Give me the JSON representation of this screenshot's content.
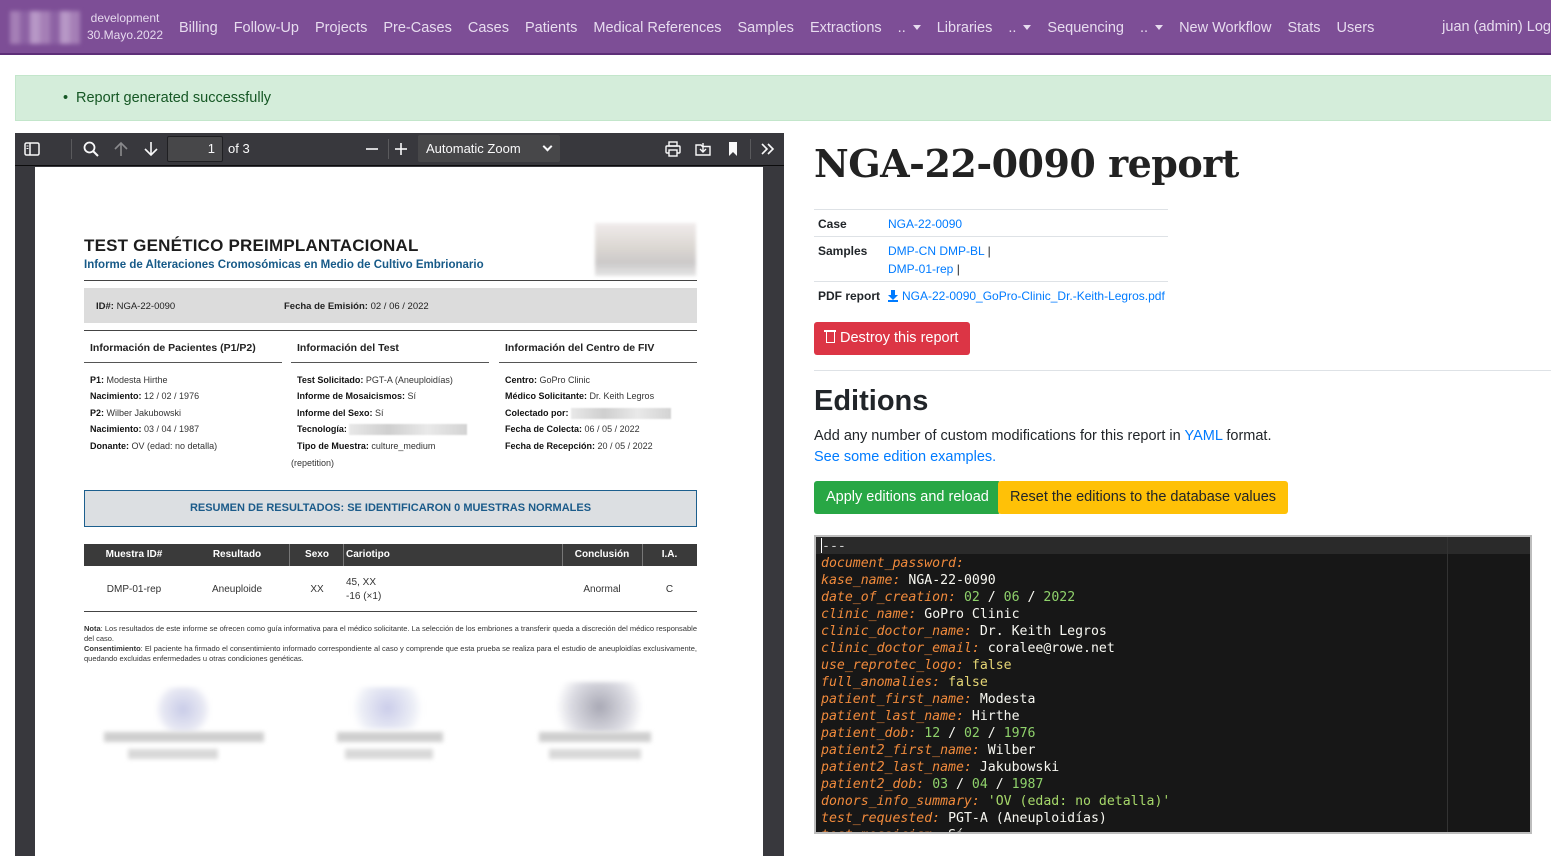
{
  "navbar": {
    "env": "development",
    "date": "30.Mayo.2022",
    "items": [
      {
        "label": "Billing"
      },
      {
        "label": "Follow-Up"
      },
      {
        "label": "Projects"
      },
      {
        "label": "Pre-Cases"
      },
      {
        "label": "Cases"
      },
      {
        "label": "Patients"
      },
      {
        "label": "Medical References"
      },
      {
        "label": "Samples"
      },
      {
        "label": "Extractions"
      },
      {
        "label": ".."
      },
      {
        "label": "Libraries"
      },
      {
        "label": ".."
      },
      {
        "label": "Sequencing"
      },
      {
        "label": ".."
      },
      {
        "label": "New Workflow"
      },
      {
        "label": "Stats"
      },
      {
        "label": "Users"
      }
    ],
    "user": "juan (admin) Log"
  },
  "alert": {
    "message": "Report generated successfully"
  },
  "pdf_viewer": {
    "page": "1",
    "of_pages": "of 3",
    "zoom": "Automatic Zoom"
  },
  "pdf_page": {
    "title": "TEST GENÉTICO PREIMPLANTACIONAL",
    "subtitle": "Informe de Alteraciones Cromosómicas en Medio de Cultivo Embrionario",
    "id_label": "ID#:",
    "id_value": "NGA-22-0090",
    "emision_label": "Fecha de Emisión:",
    "emision_value": "02 / 06 / 2022",
    "col1_title": "Información de Pacientes (P1/P2)",
    "col2_title": "Información del Test",
    "col3_title": "Información del Centro de FIV",
    "p1_label": "P1:",
    "p1_value": "Modesta Hirthe",
    "nac1_label": "Nacimiento:",
    "nac1_value": "12 / 02 / 1976",
    "p2_label": "P2:",
    "p2_value": "Wilber Jakubowski",
    "nac2_label": "Nacimiento:",
    "nac2_value": "03 / 04 / 1987",
    "donante_label": "Donante:",
    "donante_value": "OV (edad: no detalla)",
    "test_label": "Test Solicitado:",
    "test_value": "PGT-A (Aneuploidías)",
    "mosaic_label": "Informe de Mosaicismos:",
    "mosaic_value": "Sí",
    "sexo_label": "Informe del Sexo:",
    "sexo_value": "Sí",
    "tec_label": "Tecnología:",
    "muestra_label": "Tipo de Muestra:",
    "muestra_value": "culture_medium",
    "muestra_value2": "(repetition)",
    "centro_label": "Centro:",
    "centro_value": "GoPro Clinic",
    "medico_label": "Médico Solicitante:",
    "medico_value": "Dr. Keith Legros",
    "colectado_label": "Colectado por:",
    "fcolecta_label": "Fecha de Colecta:",
    "fcolecta_value": "06 / 05 / 2022",
    "frecep_label": "Fecha de Recepción:",
    "frecep_value": "20 / 05 / 2022",
    "summary": "RESUMEN DE RESULTADOS: SE IDENTIFICARON 0 MUESTRAS NORMALES",
    "table_headers": [
      "Muestra ID#",
      "Resultado",
      "Sexo",
      "Cariotipo",
      "Conclusión",
      "I.A."
    ],
    "table_row": [
      "DMP-01-rep",
      "Aneuploide",
      "XX",
      "45, XX",
      "-16 (×1)",
      "Anormal",
      "C"
    ],
    "note_label": "Nota",
    "note_text": ": Los resultados de este informe se ofrecen como guía informativa para el médico solicitante. La selección de los embriones a transferir queda a discreción del médico responsable del caso.",
    "consent_label": "Consentimiento",
    "consent_text": ": El paciente ha firmado el consentimiento informado correspondiente al caso y comprende que esta prueba se realiza para el estudio de aneuploidías exclusivamente, quedando excluidas enfermedades u otras condiciones genéticas."
  },
  "report": {
    "title": "NGA-22-0090 report",
    "case_label": "Case",
    "case_value": "NGA-22-0090",
    "samples_label": "Samples",
    "samples": [
      "DMP-CN",
      "DMP-BL",
      "DMP-01-rep"
    ],
    "pipe": "|",
    "pdf_label": "PDF report",
    "pdf_file": "NGA-22-0090_GoPro-Clinic_Dr.-Keith-Legros.pdf",
    "destroy_button": "Destroy this report"
  },
  "editions": {
    "heading": "Editions",
    "desc_before": "Add any number of custom modifications for this report in ",
    "desc_link": "YAML",
    "desc_after": " format.",
    "examples_link": "See some edition examples.",
    "apply_button": "Apply editions and reload",
    "reset_button": "Reset the editions to the database values"
  },
  "editor": {
    "lines": [
      {
        "key": "---",
        "kind": "dash"
      },
      {
        "key": "document_password",
        "value": ""
      },
      {
        "key": "kase_name",
        "value": "NGA-22-0090",
        "kind": "plain"
      },
      {
        "key": "date_of_creation",
        "value": "02 / 06 / 2022",
        "kind": "date"
      },
      {
        "key": "clinic_name",
        "value": "GoPro Clinic",
        "kind": "plain"
      },
      {
        "key": "clinic_doctor_name",
        "value": "Dr. Keith Legros",
        "kind": "plain"
      },
      {
        "key": "clinic_doctor_email",
        "value": "coralee@rowe.net",
        "kind": "plain"
      },
      {
        "key": "use_reprotec_logo",
        "value": "false",
        "kind": "bool"
      },
      {
        "key": "full_anomalies",
        "value": "false",
        "kind": "bool"
      },
      {
        "key": "patient_first_name",
        "value": "Modesta",
        "kind": "plain"
      },
      {
        "key": "patient_last_name",
        "value": "Hirthe",
        "kind": "plain"
      },
      {
        "key": "patient_dob",
        "value": "12 / 02 / 1976",
        "kind": "date"
      },
      {
        "key": "patient2_first_name",
        "value": "Wilber",
        "kind": "plain"
      },
      {
        "key": "patient2_last_name",
        "value": "Jakubowski",
        "kind": "plain"
      },
      {
        "key": "patient2_dob",
        "value": "03 / 04 / 1987",
        "kind": "date"
      },
      {
        "key": "donors_info_summary",
        "value": "'OV (edad: no detalla)'",
        "kind": "str"
      },
      {
        "key": "test_requested",
        "value": "PGT-A (Aneuploidías)",
        "kind": "plain"
      },
      {
        "key": "test_mosaicism",
        "value": "Sí",
        "kind": "plain"
      }
    ]
  }
}
